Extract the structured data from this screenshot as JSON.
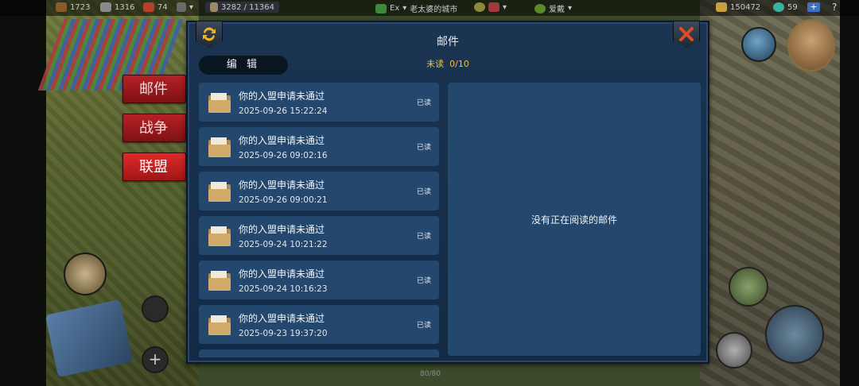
{
  "topbar": {
    "wood": "1723",
    "stone": "1316",
    "food": "74",
    "population": "3282 / 11364",
    "player_rank": "Ex",
    "city_name": "老太婆的城市",
    "alliance": "爱戴",
    "gold": "150472",
    "gems": "59",
    "plus_label": "+",
    "help_label": "?"
  },
  "side_tabs": [
    {
      "label": "邮件",
      "active": false
    },
    {
      "label": "战争",
      "active": false
    },
    {
      "label": "联盟",
      "active": true
    }
  ],
  "dialog": {
    "title": "邮件",
    "unread_label": "未读",
    "unread_count": "0/10",
    "edit_label": "编 辑",
    "empty_reader_text": "没有正在阅读的邮件"
  },
  "mails": [
    {
      "subject": "你的入盟申请未通过",
      "time": "2025-09-26  15:22:24",
      "status": "已读"
    },
    {
      "subject": "你的入盟申请未通过",
      "time": "2025-09-26  09:02:16",
      "status": "已读"
    },
    {
      "subject": "你的入盟申请未通过",
      "time": "2025-09-26  09:00:21",
      "status": "已读"
    },
    {
      "subject": "你的入盟申请未通过",
      "time": "2025-09-24  10:21:22",
      "status": "已读"
    },
    {
      "subject": "你的入盟申请未通过",
      "time": "2025-09-24  10:16:23",
      "status": "已读"
    },
    {
      "subject": "你的入盟申请未通过",
      "time": "2025-09-23  19:37:20",
      "status": "已读"
    }
  ],
  "bottom": {
    "count": "80/80"
  },
  "colors": {
    "dialog_bg": "#1a3452",
    "panel_bg": "#24476d",
    "tab_red": "#b52226",
    "unread_yellow": "#e8c24a"
  }
}
